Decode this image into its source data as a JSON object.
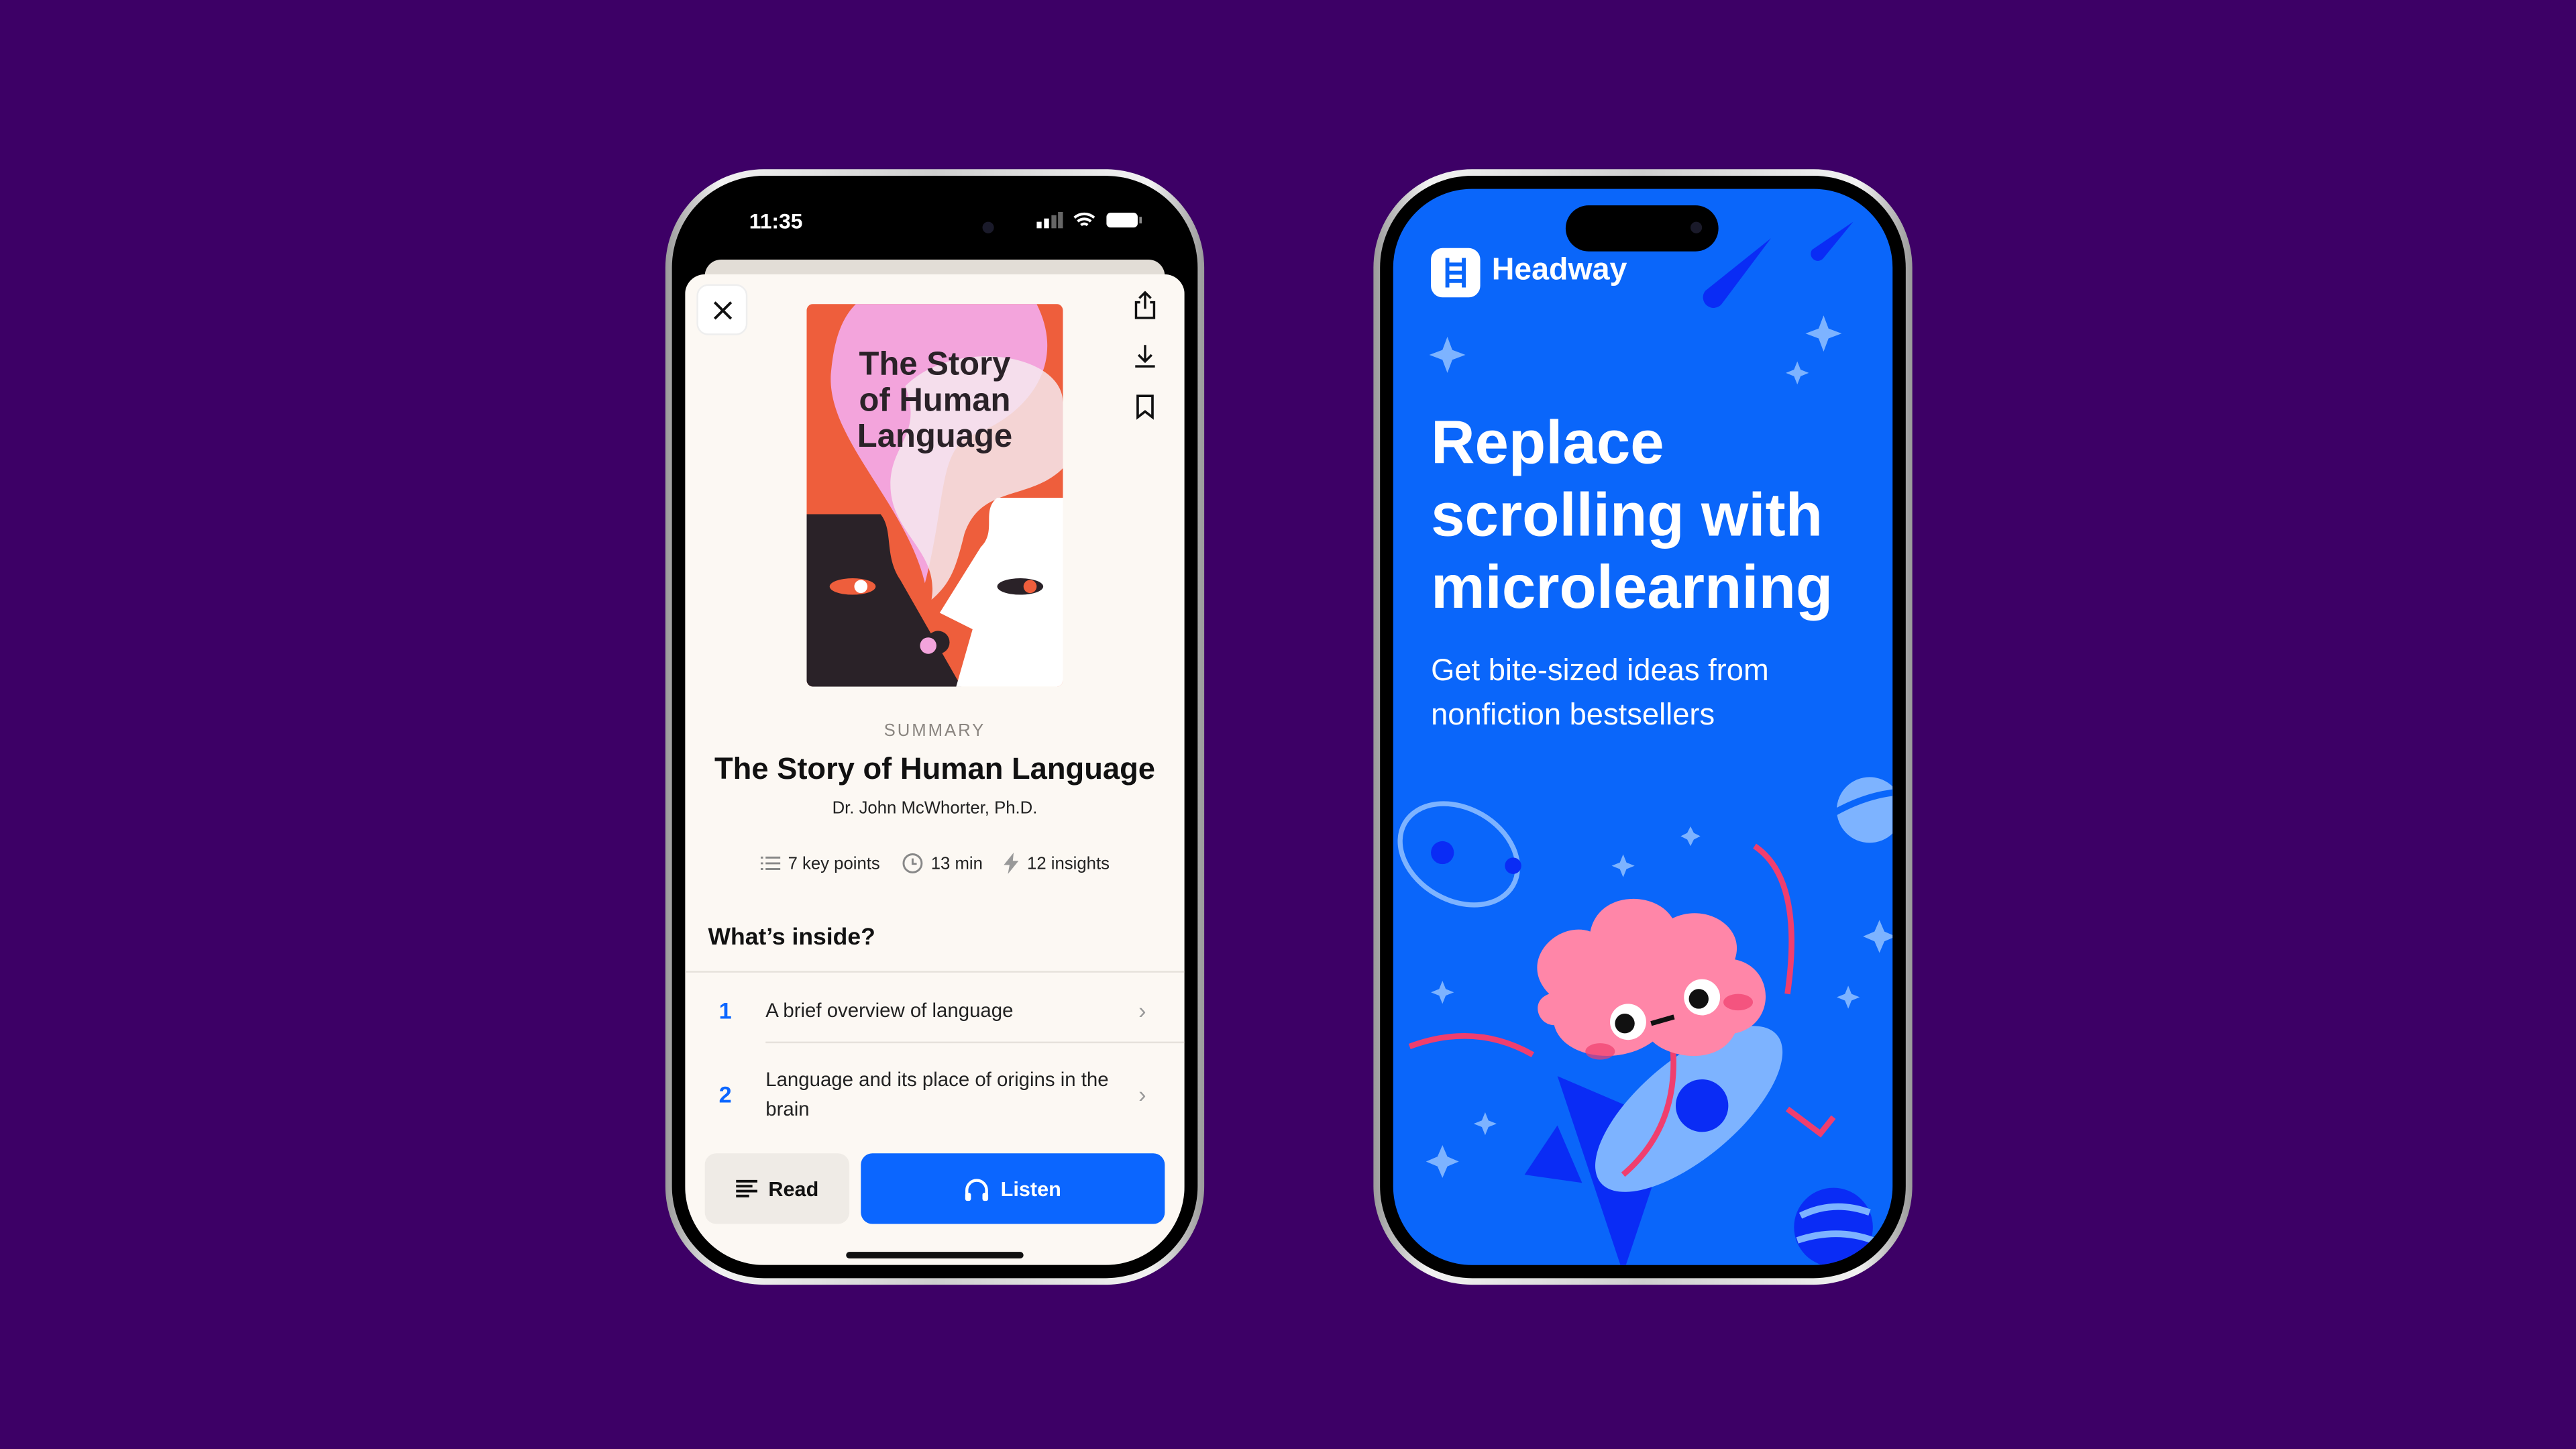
{
  "colors": {
    "background": "#3D0066",
    "accent": "#0B66FF",
    "sheet": "#FCF8F3",
    "promo_blue": "#0A66FA"
  },
  "left_phone": {
    "status": {
      "time": "11:35",
      "icons": [
        "signal-icon",
        "wifi-icon",
        "battery-icon"
      ]
    },
    "toolbar": {
      "close_icon": "close-icon",
      "actions": [
        "share-icon",
        "download-icon",
        "bookmark-icon"
      ]
    },
    "cover": {
      "title_lines": [
        "The Story",
        "of Human",
        "Language"
      ]
    },
    "book": {
      "kicker": "SUMMARY",
      "title": "The Story of Human Language",
      "author": "Dr. John McWhorter, Ph.D."
    },
    "meta": [
      {
        "icon": "list-icon",
        "label": "7 key points"
      },
      {
        "icon": "clock-icon",
        "label": "13 min"
      },
      {
        "icon": "lightning-icon",
        "label": "12 insights"
      }
    ],
    "section_title": "What’s inside?",
    "chapters": [
      {
        "number": "1",
        "title": "A brief overview of language"
      },
      {
        "number": "2",
        "title": "Language and its place of origins in the brain"
      }
    ],
    "actions": {
      "read": "Read",
      "listen": "Listen"
    }
  },
  "right_phone": {
    "brand": "Headway",
    "headline": [
      "Replace",
      "scrolling with",
      "microlearning"
    ],
    "subtitle": [
      "Get bite-sized ideas from",
      "nonfiction bestsellers"
    ]
  }
}
